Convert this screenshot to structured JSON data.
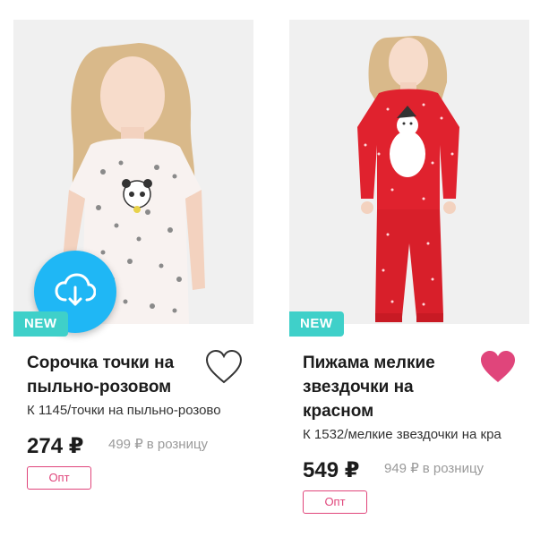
{
  "products": [
    {
      "badge": "NEW",
      "title_line1": "Сорочка точки на",
      "title_line2": "пыльно-розовом",
      "sku": "К 1145/точки на пыльно-розово",
      "price": "274 ₽",
      "retail_price": "499 ₽",
      "retail_label": "в розницу",
      "wholesale_label": "Опт",
      "favorited": false
    },
    {
      "badge": "NEW",
      "title_line1": "Пижама мелкие",
      "title_line2": "звездочки на",
      "title_line3": "красном",
      "sku": "К 1532/мелкие звездочки на кра",
      "price": "549 ₽",
      "retail_price": "949 ₽",
      "retail_label": "в розницу",
      "wholesale_label": "Опт",
      "favorited": true
    }
  ],
  "icons": {
    "upload": "cloud-upload-icon",
    "heart_outline": "heart-outline-icon",
    "heart_filled": "heart-filled-icon"
  },
  "colors": {
    "badge": "#3fd0c9",
    "accent_pink": "#e0457b",
    "fab_blue": "#1fb7f5"
  }
}
